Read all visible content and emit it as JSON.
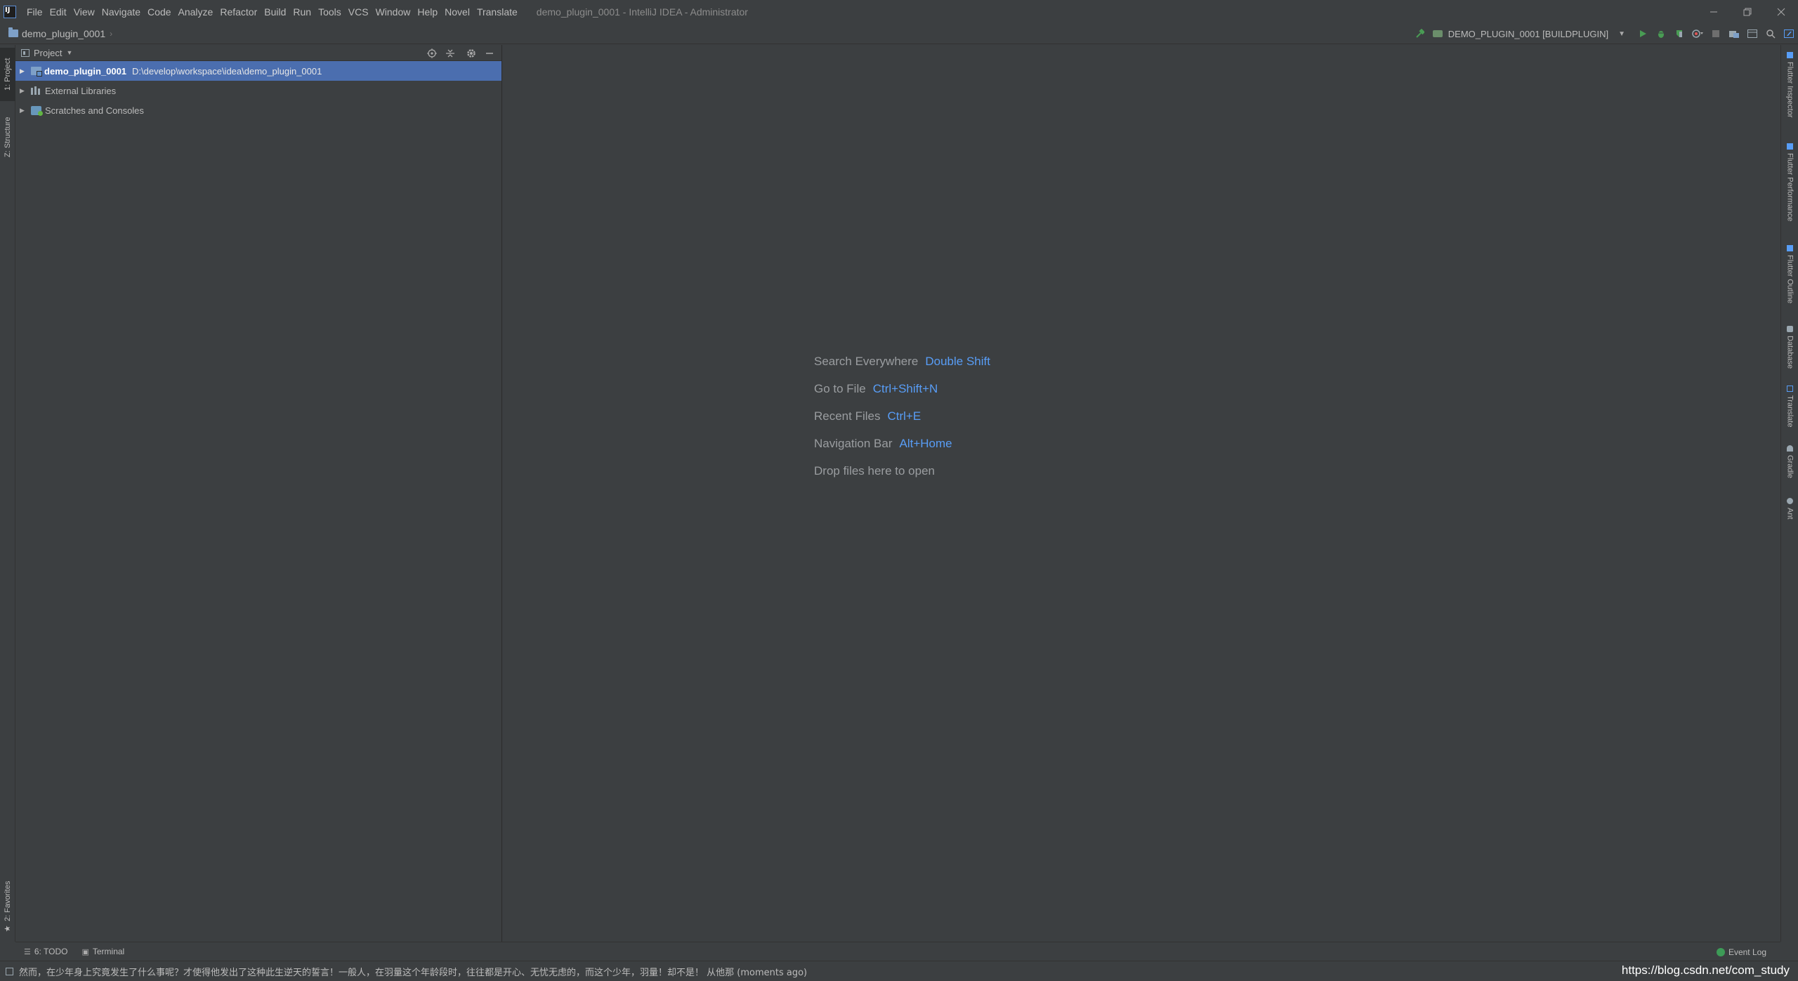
{
  "menubar": {
    "items": [
      "File",
      "Edit",
      "View",
      "Navigate",
      "Code",
      "Analyze",
      "Refactor",
      "Build",
      "Run",
      "Tools",
      "VCS",
      "Window",
      "Help",
      "Novel",
      "Translate"
    ],
    "window_title": "demo_plugin_0001 - IntelliJ IDEA - Administrator",
    "controls": [
      "minimize-icon",
      "restore-icon",
      "close-icon"
    ]
  },
  "navbar": {
    "breadcrumb": "demo_plugin_0001",
    "run_config": "DEMO_PLUGIN_0001 [BUILDPLUGIN]",
    "icons": [
      "hammer-icon",
      "run-icon",
      "debug-icon",
      "coverage-icon",
      "profile-icon",
      "stop-icon",
      "project-structure-icon",
      "layout-icon",
      "search-icon",
      "flutter-icon"
    ]
  },
  "left_stripe": {
    "project": "1: Project",
    "structure": "Z: Structure",
    "favorites": "2: Favorites"
  },
  "project_panel": {
    "title": "Project",
    "tree": [
      {
        "label": "demo_plugin_0001",
        "path": "D:\\develop\\workspace\\idea\\demo_plugin_0001",
        "selected": true
      },
      {
        "label": "External Libraries"
      },
      {
        "label": "Scratches and Consoles"
      }
    ]
  },
  "editor": {
    "hints": [
      {
        "label": "Search Everywhere",
        "key": "Double Shift"
      },
      {
        "label": "Go to File",
        "key": "Ctrl+Shift+N"
      },
      {
        "label": "Recent Files",
        "key": "Ctrl+E"
      },
      {
        "label": "Navigation Bar",
        "key": "Alt+Home"
      },
      {
        "label": "Drop files here to open",
        "key": ""
      }
    ]
  },
  "right_stripe": {
    "items": [
      "Flutter Inspector",
      "Flutter Performance",
      "Flutter Outline",
      "Database",
      "Translate",
      "Gradle",
      "Ant"
    ]
  },
  "bottom_bar": {
    "todo": "6: TODO",
    "terminal": "Terminal",
    "event_log": "Event Log"
  },
  "status_bar": {
    "message": "然而，在少年身上究竟发生了什么事呢？才使得他发出了这种此生逆天的誓言！一般人，在羽量这个年龄段时，往往都是开心、无忧无虑的，而这个少年，羽量！却不是！ 从他那 (moments ago)",
    "watermark": "https://blog.csdn.net/com_study"
  },
  "colors": {
    "background": "#3c3f41",
    "selection": "#4b6eaf",
    "shortcut": "#589df6",
    "run_green": "#499c54"
  }
}
